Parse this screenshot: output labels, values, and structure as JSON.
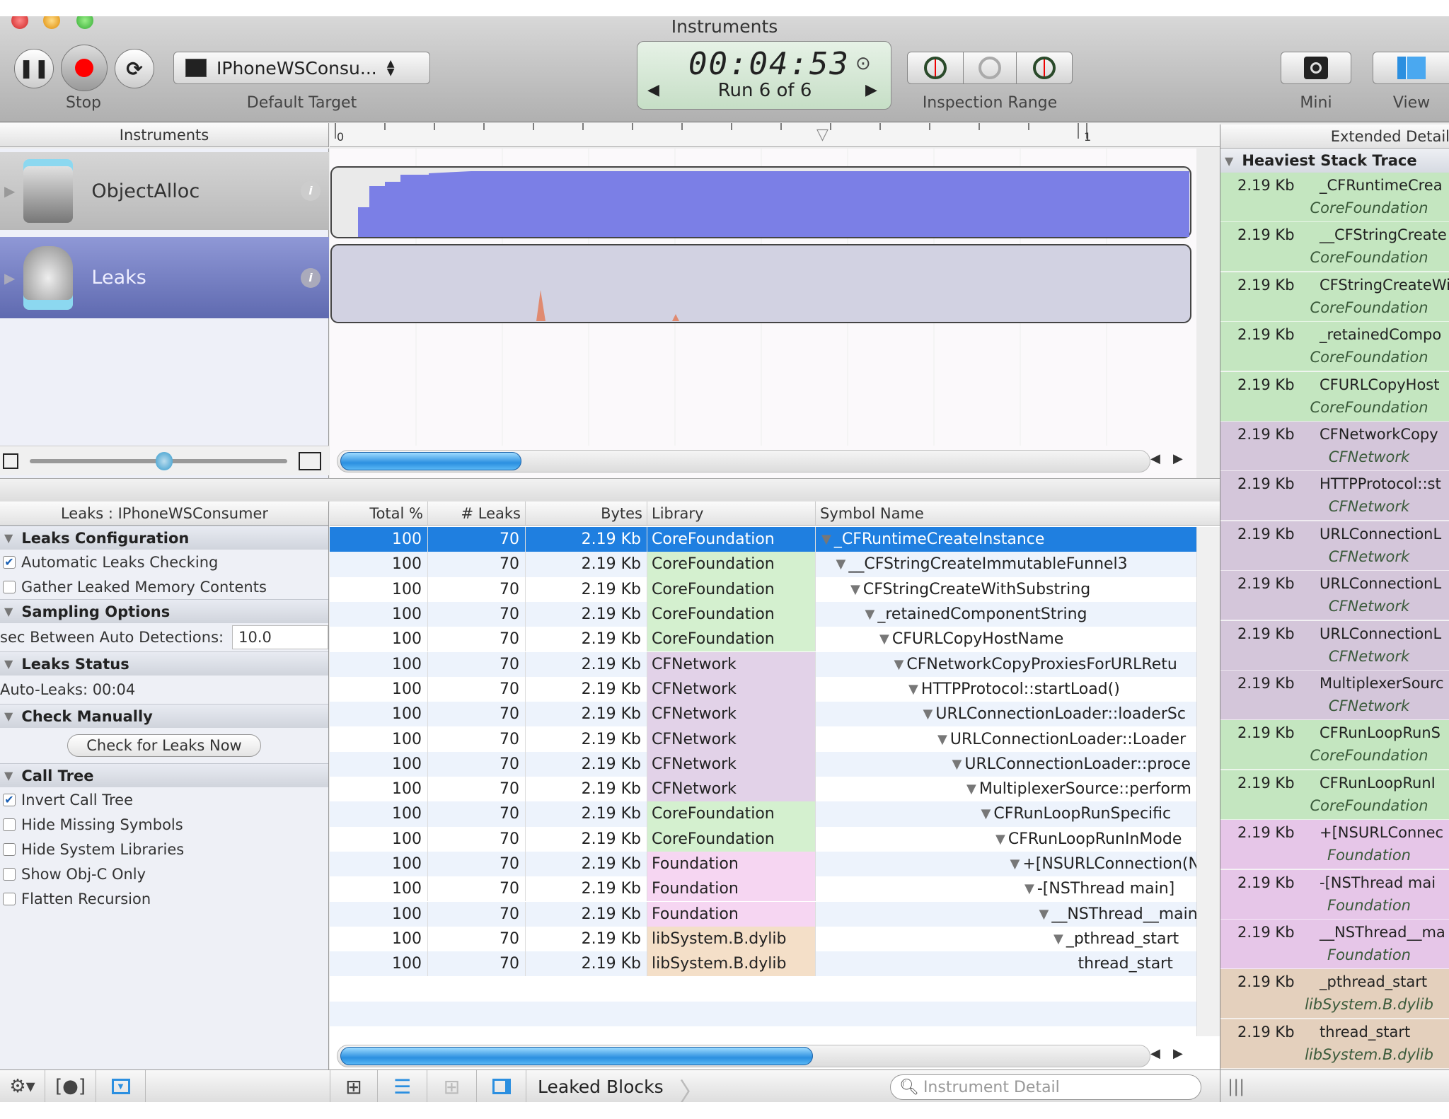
{
  "window": {
    "title": "Instruments"
  },
  "toolbar": {
    "stop_label": "Stop",
    "target_value": "IPhoneWSConsu...",
    "target_label": "Default Target",
    "timer": "00:04:53",
    "run": "Run 6 of 6",
    "inspection_label": "Inspection Range",
    "mini_label": "Mini",
    "view_label": "View"
  },
  "timeline": {
    "header": "Instruments",
    "ruler_ticks": [
      "0",
      "1"
    ],
    "instruments": [
      {
        "name": "ObjectAlloc",
        "color": "#7b7fe6"
      },
      {
        "name": "Leaks",
        "color": "#e08a70"
      }
    ]
  },
  "detail": {
    "panel_title": "Leaks : IPhoneWSConsumer",
    "sections": {
      "config": "Leaks Configuration",
      "auto_check": "Automatic Leaks Checking",
      "gather": "Gather Leaked Memory Contents",
      "sampling": "Sampling Options",
      "sec_label": "sec Between Auto Detections:",
      "sec_value": "10.0",
      "status": "Leaks Status",
      "auto_leaks": "Auto-Leaks: 00:04",
      "manual": "Check Manually",
      "check_now": "Check for Leaks Now",
      "call_tree": "Call Tree",
      "invert": "Invert Call Tree",
      "hide_missing": "Hide Missing Symbols",
      "hide_system": "Hide System Libraries",
      "objc_only": "Show Obj-C Only",
      "flatten": "Flatten Recursion"
    }
  },
  "table": {
    "columns": [
      "Total %",
      "# Leaks",
      "Bytes",
      "Library",
      "Symbol Name"
    ],
    "rows": [
      {
        "total": "100",
        "leaks": "70",
        "bytes": "2.19 Kb",
        "library": "CoreFoundation",
        "symbol": "_CFRuntimeCreateInstance"
      },
      {
        "total": "100",
        "leaks": "70",
        "bytes": "2.19 Kb",
        "library": "CoreFoundation",
        "symbol": "__CFStringCreateImmutableFunnel3"
      },
      {
        "total": "100",
        "leaks": "70",
        "bytes": "2.19 Kb",
        "library": "CoreFoundation",
        "symbol": "CFStringCreateWithSubstring"
      },
      {
        "total": "100",
        "leaks": "70",
        "bytes": "2.19 Kb",
        "library": "CoreFoundation",
        "symbol": "_retainedComponentString"
      },
      {
        "total": "100",
        "leaks": "70",
        "bytes": "2.19 Kb",
        "library": "CoreFoundation",
        "symbol": "CFURLCopyHostName"
      },
      {
        "total": "100",
        "leaks": "70",
        "bytes": "2.19 Kb",
        "library": "CFNetwork",
        "symbol": "CFNetworkCopyProxiesForURLRetu"
      },
      {
        "total": "100",
        "leaks": "70",
        "bytes": "2.19 Kb",
        "library": "CFNetwork",
        "symbol": "HTTPProtocol::startLoad()"
      },
      {
        "total": "100",
        "leaks": "70",
        "bytes": "2.19 Kb",
        "library": "CFNetwork",
        "symbol": "URLConnectionLoader::loaderSc"
      },
      {
        "total": "100",
        "leaks": "70",
        "bytes": "2.19 Kb",
        "library": "CFNetwork",
        "symbol": "URLConnectionLoader::Loader"
      },
      {
        "total": "100",
        "leaks": "70",
        "bytes": "2.19 Kb",
        "library": "CFNetwork",
        "symbol": "URLConnectionLoader::proce"
      },
      {
        "total": "100",
        "leaks": "70",
        "bytes": "2.19 Kb",
        "library": "CFNetwork",
        "symbol": "MultiplexerSource::perform"
      },
      {
        "total": "100",
        "leaks": "70",
        "bytes": "2.19 Kb",
        "library": "CoreFoundation",
        "symbol": "CFRunLoopRunSpecific"
      },
      {
        "total": "100",
        "leaks": "70",
        "bytes": "2.19 Kb",
        "library": "CoreFoundation",
        "symbol": "CFRunLoopRunInMode"
      },
      {
        "total": "100",
        "leaks": "70",
        "bytes": "2.19 Kb",
        "library": "Foundation",
        "symbol": "+[NSURLConnection(N"
      },
      {
        "total": "100",
        "leaks": "70",
        "bytes": "2.19 Kb",
        "library": "Foundation",
        "symbol": "-[NSThread main]"
      },
      {
        "total": "100",
        "leaks": "70",
        "bytes": "2.19 Kb",
        "library": "Foundation",
        "symbol": "__NSThread__main"
      },
      {
        "total": "100",
        "leaks": "70",
        "bytes": "2.19 Kb",
        "library": "libSystem.B.dylib",
        "symbol": "_pthread_start"
      },
      {
        "total": "100",
        "leaks": "70",
        "bytes": "2.19 Kb",
        "library": "libSystem.B.dylib",
        "symbol": "thread_start"
      }
    ]
  },
  "extended": {
    "title": "Extended Detail",
    "section": "Heaviest Stack Trace",
    "entries": [
      {
        "size": "2.19 Kb",
        "symbol": "_CFRuntimeCrea",
        "library": "CoreFoundation"
      },
      {
        "size": "2.19 Kb",
        "symbol": "__CFStringCreate",
        "library": "CoreFoundation"
      },
      {
        "size": "2.19 Kb",
        "symbol": "CFStringCreateWi",
        "library": "CoreFoundation"
      },
      {
        "size": "2.19 Kb",
        "symbol": "_retainedCompo",
        "library": "CoreFoundation"
      },
      {
        "size": "2.19 Kb",
        "symbol": "CFURLCopyHost",
        "library": "CoreFoundation"
      },
      {
        "size": "2.19 Kb",
        "symbol": "CFNetworkCopy",
        "library": "CFNetwork"
      },
      {
        "size": "2.19 Kb",
        "symbol": "HTTPProtocol::st",
        "library": "CFNetwork"
      },
      {
        "size": "2.19 Kb",
        "symbol": "URLConnectionL",
        "library": "CFNetwork"
      },
      {
        "size": "2.19 Kb",
        "symbol": "URLConnectionL",
        "library": "CFNetwork"
      },
      {
        "size": "2.19 Kb",
        "symbol": "URLConnectionL",
        "library": "CFNetwork"
      },
      {
        "size": "2.19 Kb",
        "symbol": "MultiplexerSourc",
        "library": "CFNetwork"
      },
      {
        "size": "2.19 Kb",
        "symbol": "CFRunLoopRunS",
        "library": "CoreFoundation"
      },
      {
        "size": "2.19 Kb",
        "symbol": "CFRunLoopRunI",
        "library": "CoreFoundation"
      },
      {
        "size": "2.19 Kb",
        "symbol": "+[NSURLConnec",
        "library": "Foundation"
      },
      {
        "size": "2.19 Kb",
        "symbol": "-[NSThread mai",
        "library": "Foundation"
      },
      {
        "size": "2.19 Kb",
        "symbol": "__NSThread__ma",
        "library": "Foundation"
      },
      {
        "size": "2.19 Kb",
        "symbol": "_pthread_start",
        "library": "libSystem.B.dylib"
      },
      {
        "size": "2.19 Kb",
        "symbol": "thread_start",
        "library": "libSystem.B.dylib"
      }
    ]
  },
  "bottom": {
    "breadcrumb": "Leaked Blocks",
    "search_placeholder": "Instrument Detail"
  },
  "library_colors": {
    "CoreFoundation": "#d4f0cf",
    "CFNetwork": "#e2d2e8",
    "Foundation": "#f6d6f2",
    "libSystem.B.dylib": "#f4dfc8"
  },
  "extended_colors": {
    "CoreFoundation": "#c4e6c0",
    "CFNetwork": "#d4c6da",
    "Foundation": "#e6c6e8",
    "libSystem.B.dylib": "#e4d0bd"
  },
  "selection_color": "#1f7fe0"
}
